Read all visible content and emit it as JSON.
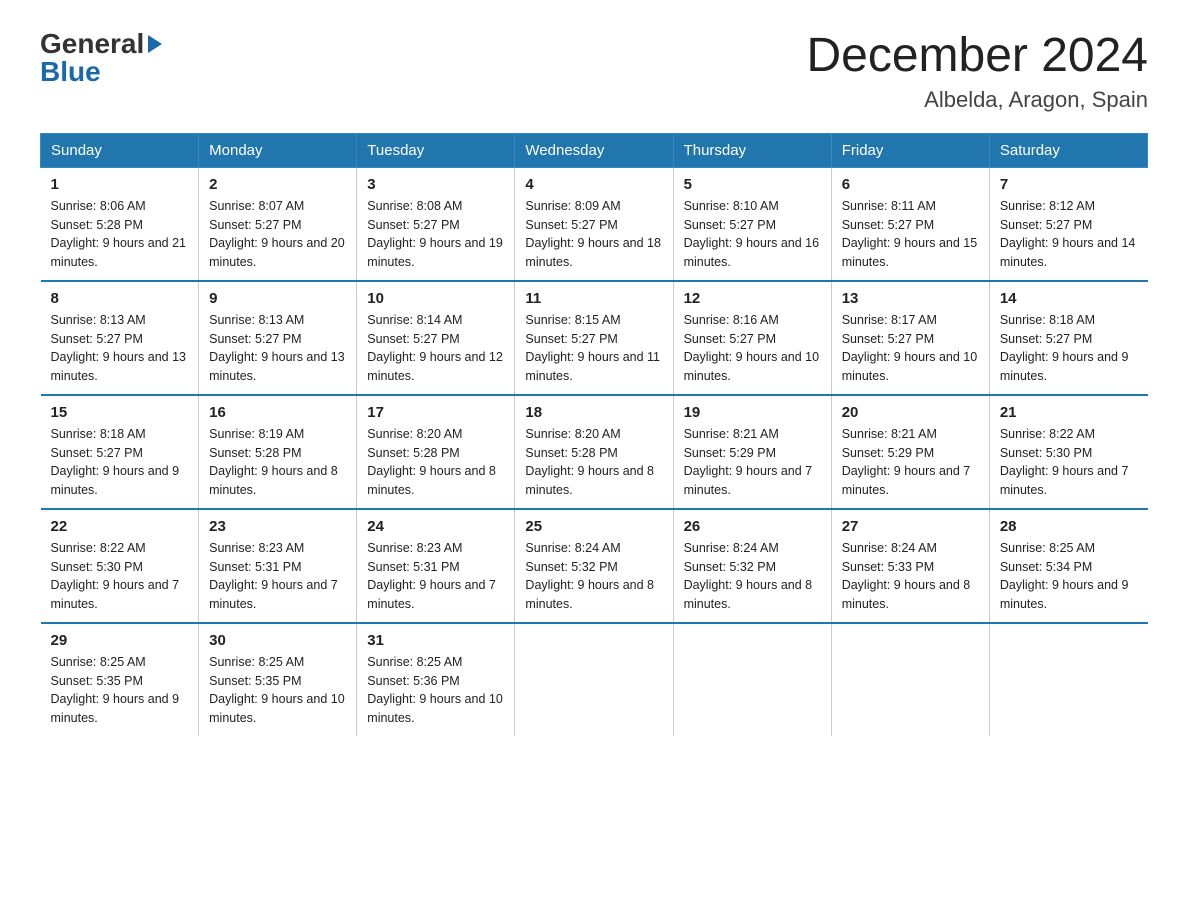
{
  "logo": {
    "general": "General",
    "blue": "Blue"
  },
  "title": {
    "month_year": "December 2024",
    "location": "Albelda, Aragon, Spain"
  },
  "headers": [
    "Sunday",
    "Monday",
    "Tuesday",
    "Wednesday",
    "Thursday",
    "Friday",
    "Saturday"
  ],
  "weeks": [
    [
      {
        "day": "1",
        "sunrise": "8:06 AM",
        "sunset": "5:28 PM",
        "daylight": "9 hours and 21 minutes."
      },
      {
        "day": "2",
        "sunrise": "8:07 AM",
        "sunset": "5:27 PM",
        "daylight": "9 hours and 20 minutes."
      },
      {
        "day": "3",
        "sunrise": "8:08 AM",
        "sunset": "5:27 PM",
        "daylight": "9 hours and 19 minutes."
      },
      {
        "day": "4",
        "sunrise": "8:09 AM",
        "sunset": "5:27 PM",
        "daylight": "9 hours and 18 minutes."
      },
      {
        "day": "5",
        "sunrise": "8:10 AM",
        "sunset": "5:27 PM",
        "daylight": "9 hours and 16 minutes."
      },
      {
        "day": "6",
        "sunrise": "8:11 AM",
        "sunset": "5:27 PM",
        "daylight": "9 hours and 15 minutes."
      },
      {
        "day": "7",
        "sunrise": "8:12 AM",
        "sunset": "5:27 PM",
        "daylight": "9 hours and 14 minutes."
      }
    ],
    [
      {
        "day": "8",
        "sunrise": "8:13 AM",
        "sunset": "5:27 PM",
        "daylight": "9 hours and 13 minutes."
      },
      {
        "day": "9",
        "sunrise": "8:13 AM",
        "sunset": "5:27 PM",
        "daylight": "9 hours and 13 minutes."
      },
      {
        "day": "10",
        "sunrise": "8:14 AM",
        "sunset": "5:27 PM",
        "daylight": "9 hours and 12 minutes."
      },
      {
        "day": "11",
        "sunrise": "8:15 AM",
        "sunset": "5:27 PM",
        "daylight": "9 hours and 11 minutes."
      },
      {
        "day": "12",
        "sunrise": "8:16 AM",
        "sunset": "5:27 PM",
        "daylight": "9 hours and 10 minutes."
      },
      {
        "day": "13",
        "sunrise": "8:17 AM",
        "sunset": "5:27 PM",
        "daylight": "9 hours and 10 minutes."
      },
      {
        "day": "14",
        "sunrise": "8:18 AM",
        "sunset": "5:27 PM",
        "daylight": "9 hours and 9 minutes."
      }
    ],
    [
      {
        "day": "15",
        "sunrise": "8:18 AM",
        "sunset": "5:27 PM",
        "daylight": "9 hours and 9 minutes."
      },
      {
        "day": "16",
        "sunrise": "8:19 AM",
        "sunset": "5:28 PM",
        "daylight": "9 hours and 8 minutes."
      },
      {
        "day": "17",
        "sunrise": "8:20 AM",
        "sunset": "5:28 PM",
        "daylight": "9 hours and 8 minutes."
      },
      {
        "day": "18",
        "sunrise": "8:20 AM",
        "sunset": "5:28 PM",
        "daylight": "9 hours and 8 minutes."
      },
      {
        "day": "19",
        "sunrise": "8:21 AM",
        "sunset": "5:29 PM",
        "daylight": "9 hours and 7 minutes."
      },
      {
        "day": "20",
        "sunrise": "8:21 AM",
        "sunset": "5:29 PM",
        "daylight": "9 hours and 7 minutes."
      },
      {
        "day": "21",
        "sunrise": "8:22 AM",
        "sunset": "5:30 PM",
        "daylight": "9 hours and 7 minutes."
      }
    ],
    [
      {
        "day": "22",
        "sunrise": "8:22 AM",
        "sunset": "5:30 PM",
        "daylight": "9 hours and 7 minutes."
      },
      {
        "day": "23",
        "sunrise": "8:23 AM",
        "sunset": "5:31 PM",
        "daylight": "9 hours and 7 minutes."
      },
      {
        "day": "24",
        "sunrise": "8:23 AM",
        "sunset": "5:31 PM",
        "daylight": "9 hours and 7 minutes."
      },
      {
        "day": "25",
        "sunrise": "8:24 AM",
        "sunset": "5:32 PM",
        "daylight": "9 hours and 8 minutes."
      },
      {
        "day": "26",
        "sunrise": "8:24 AM",
        "sunset": "5:32 PM",
        "daylight": "9 hours and 8 minutes."
      },
      {
        "day": "27",
        "sunrise": "8:24 AM",
        "sunset": "5:33 PM",
        "daylight": "9 hours and 8 minutes."
      },
      {
        "day": "28",
        "sunrise": "8:25 AM",
        "sunset": "5:34 PM",
        "daylight": "9 hours and 9 minutes."
      }
    ],
    [
      {
        "day": "29",
        "sunrise": "8:25 AM",
        "sunset": "5:35 PM",
        "daylight": "9 hours and 9 minutes."
      },
      {
        "day": "30",
        "sunrise": "8:25 AM",
        "sunset": "5:35 PM",
        "daylight": "9 hours and 10 minutes."
      },
      {
        "day": "31",
        "sunrise": "8:25 AM",
        "sunset": "5:36 PM",
        "daylight": "9 hours and 10 minutes."
      },
      null,
      null,
      null,
      null
    ]
  ]
}
